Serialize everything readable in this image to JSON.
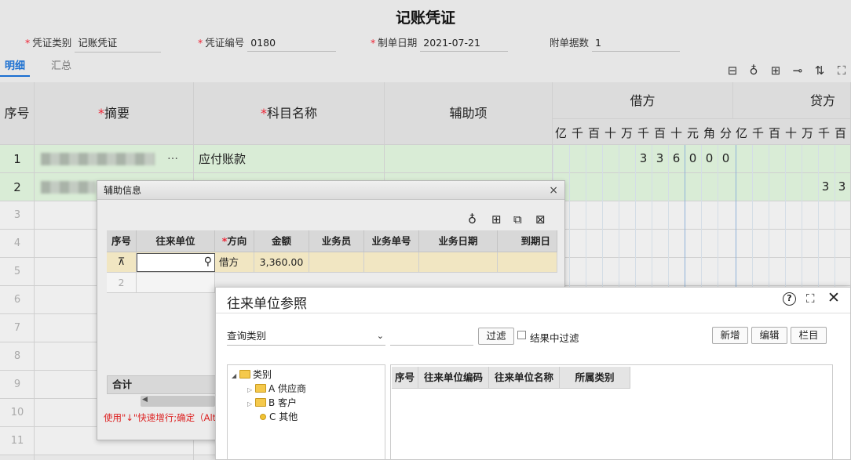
{
  "page": {
    "title": "记账凭证"
  },
  "header": {
    "voucher_type_label": "凭证类别",
    "voucher_type_value": "记账凭证",
    "voucher_no_label": "凭证编号",
    "voucher_no_value": "0180",
    "date_label": "制单日期",
    "date_value": "2021-07-21",
    "attach_label": "附单据数",
    "attach_value": "1"
  },
  "tabs": [
    {
      "label": "明细"
    },
    {
      "label": "汇总"
    }
  ],
  "grid": {
    "col_seq": "序号",
    "col_summary": "摘要",
    "col_account": "科目名称",
    "col_aux": "辅助项",
    "col_debit": "借方",
    "col_credit": "贷方",
    "digits_debit": [
      "亿",
      "千",
      "百",
      "十",
      "万",
      "千",
      "百",
      "十",
      "元",
      "角",
      "分"
    ],
    "digits_credit": [
      "亿",
      "千",
      "百",
      "十",
      "万",
      "千",
      "百"
    ],
    "rows": [
      {
        "seq": "1",
        "summary_suffix": "…",
        "account": "应付账款",
        "debit_digits": [
          "3",
          "3",
          "6",
          "0",
          "0",
          "0"
        ]
      },
      {
        "seq": "2",
        "credit_digits": [
          "3",
          "3"
        ]
      },
      {
        "seq": "3"
      },
      {
        "seq": "4"
      },
      {
        "seq": "5"
      },
      {
        "seq": "6"
      },
      {
        "seq": "7"
      },
      {
        "seq": "8"
      },
      {
        "seq": "9"
      },
      {
        "seq": "10"
      },
      {
        "seq": "11"
      }
    ]
  },
  "aux_dialog": {
    "title": "辅助信息",
    "close": "×",
    "columns": [
      "序号",
      "往来单位",
      "方向",
      "金额",
      "业务员",
      "业务单号",
      "业务日期",
      "到期日"
    ],
    "row1": {
      "direction": "借方",
      "amount": "3,360.00"
    },
    "row2_seq": "2",
    "footer_total": "合计",
    "hint": "使用\"↓\"快速增行;确定（Alt+"
  },
  "ref_dialog": {
    "title": "往来单位参照",
    "query_label": "查询类别",
    "filter_button": "过滤",
    "filter_in_results": "结果中过滤",
    "new_button": "新增",
    "edit_button": "编辑",
    "column_button": "栏目",
    "tree": {
      "root": "类别",
      "children": [
        "A 供应商",
        "B 客户",
        "C 其他"
      ]
    },
    "table_columns": [
      "序号",
      "往来单位编码",
      "往来单位名称",
      "所属类别"
    ]
  }
}
